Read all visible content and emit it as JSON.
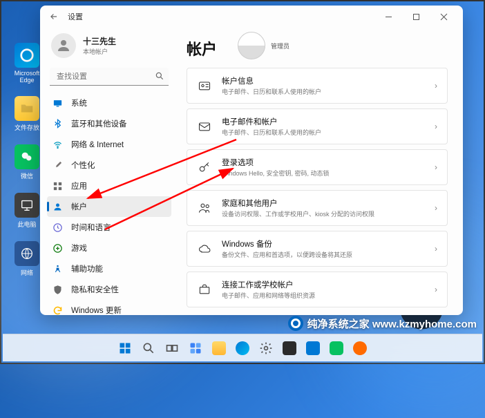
{
  "window": {
    "title": "设置"
  },
  "user": {
    "name": "十三先生",
    "type": "本地帐户"
  },
  "search": {
    "placeholder": "查找设置"
  },
  "nav": [
    {
      "key": "system",
      "label": "系统",
      "color": "#0078d4"
    },
    {
      "key": "bluetooth",
      "label": "蓝牙和其他设备",
      "color": "#0078d4"
    },
    {
      "key": "network",
      "label": "网络 & Internet",
      "color": "#0099bc"
    },
    {
      "key": "personalize",
      "label": "个性化",
      "color": "#7a7574"
    },
    {
      "key": "apps",
      "label": "应用",
      "color": "#e74856"
    },
    {
      "key": "accounts",
      "label": "帐户",
      "color": "#0078d4",
      "active": true
    },
    {
      "key": "time",
      "label": "时间和语言",
      "color": "#6b69d6"
    },
    {
      "key": "gaming",
      "label": "游戏",
      "color": "#107c10"
    },
    {
      "key": "accessibility",
      "label": "辅助功能",
      "color": "#0067c0"
    },
    {
      "key": "privacy",
      "label": "隐私和安全性",
      "color": "#6b6b6b"
    },
    {
      "key": "update",
      "label": "Windows 更新",
      "color": "#ffb900"
    }
  ],
  "main": {
    "title": "帐户",
    "admin_label": "管理员",
    "cards": [
      {
        "title": "帐户信息",
        "sub": "电子邮件、日历和联系人使用的帐户"
      },
      {
        "title": "电子邮件和帐户",
        "sub": "电子邮件、日历和联系人使用的帐户"
      },
      {
        "title": "登录选项",
        "sub": "Windows Hello, 安全密钥, 密码, 动态锁"
      },
      {
        "title": "家庭和其他用户",
        "sub": "设备访问权限、工作或学校用户、kiosk 分配的访问权限"
      },
      {
        "title": "Windows 备份",
        "sub": "备份文件、应用和首选项，以便跨设备将其还原"
      },
      {
        "title": "连接工作或学校帐户",
        "sub": "电子邮件、应用和网络等组织资源"
      }
    ]
  },
  "desktop": {
    "edge": "Microsoft Edge",
    "folder": "文件存放",
    "wechat": "微信",
    "thispc": "此电脑",
    "network": "网络"
  },
  "watermark": "纯净系统之家 www.kzmyhome.com"
}
